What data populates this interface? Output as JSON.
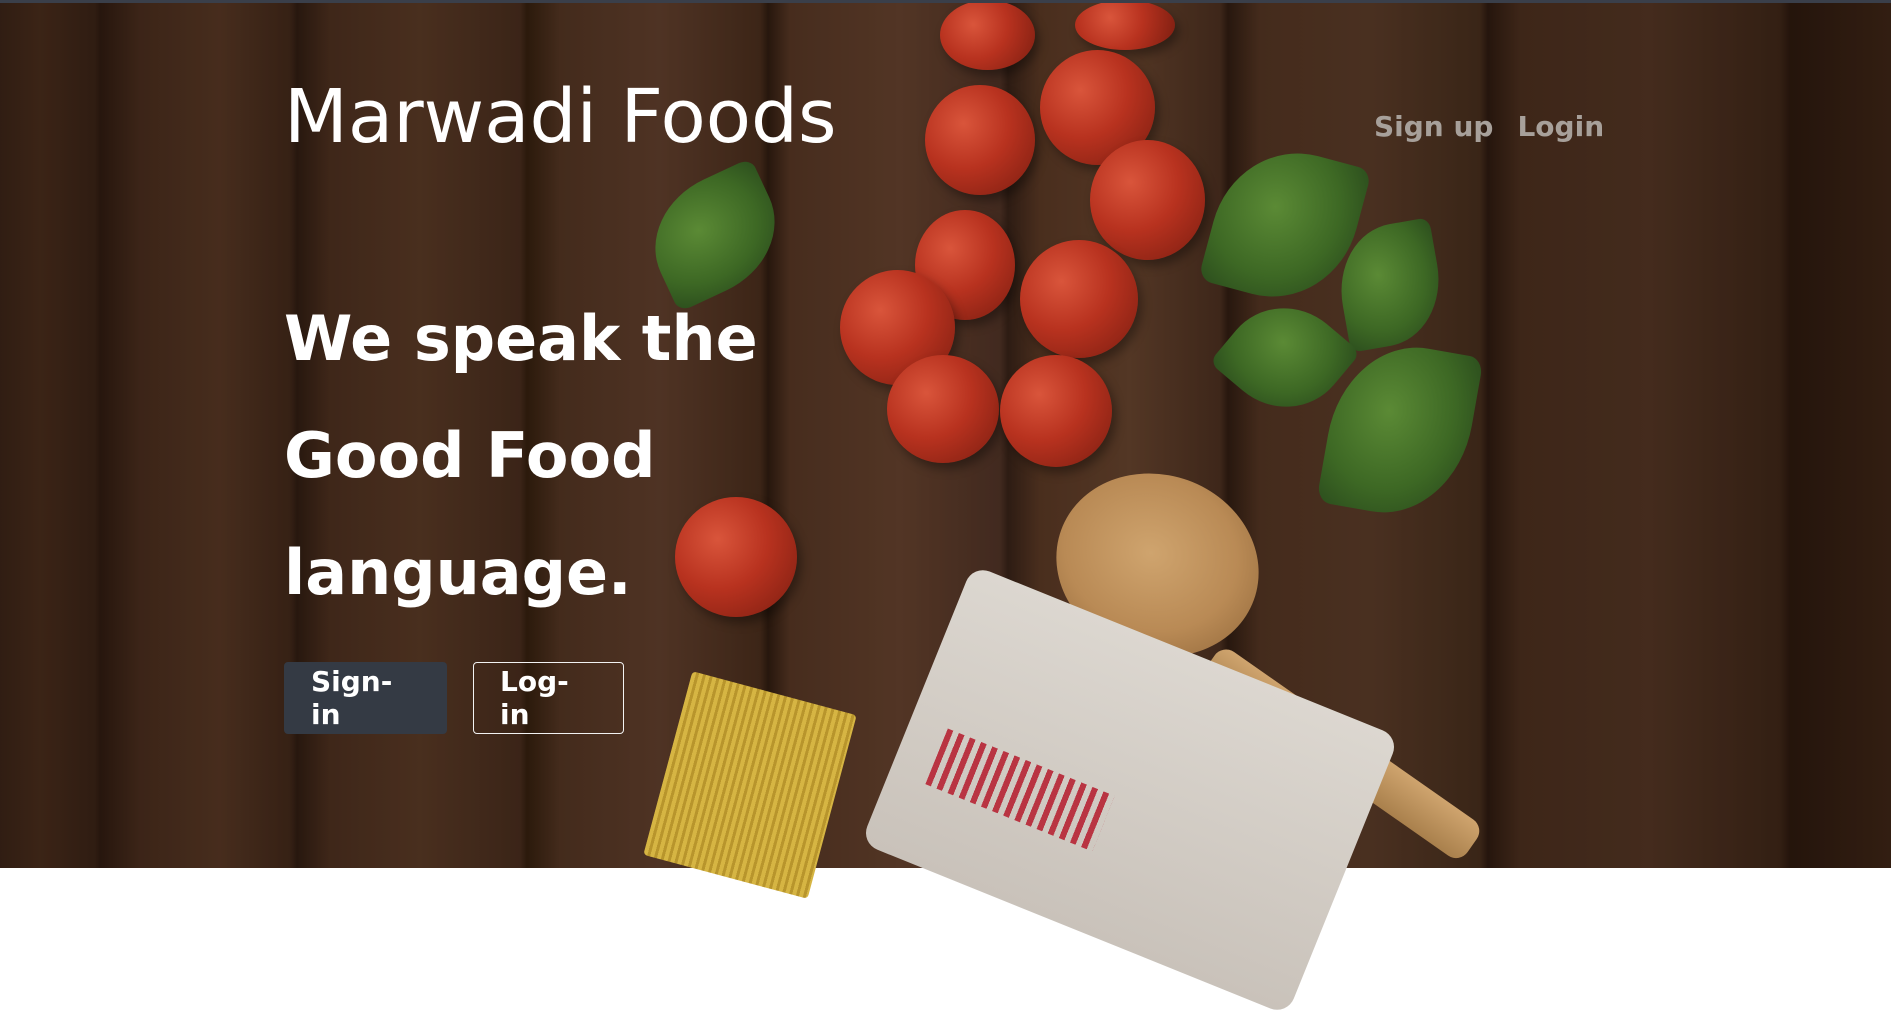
{
  "brand": {
    "name": "Marwadi Foods"
  },
  "nav": {
    "signup_label": "Sign up",
    "login_label": "Login"
  },
  "hero": {
    "headline_lines": [
      "We speak the",
      "Good Food",
      "language."
    ],
    "primary_button_label": "Sign-in",
    "secondary_button_label": "Log-in"
  },
  "colors": {
    "primary_button_bg": "#343a44",
    "nav_link": "#a7a09a",
    "text": "#ffffff"
  }
}
